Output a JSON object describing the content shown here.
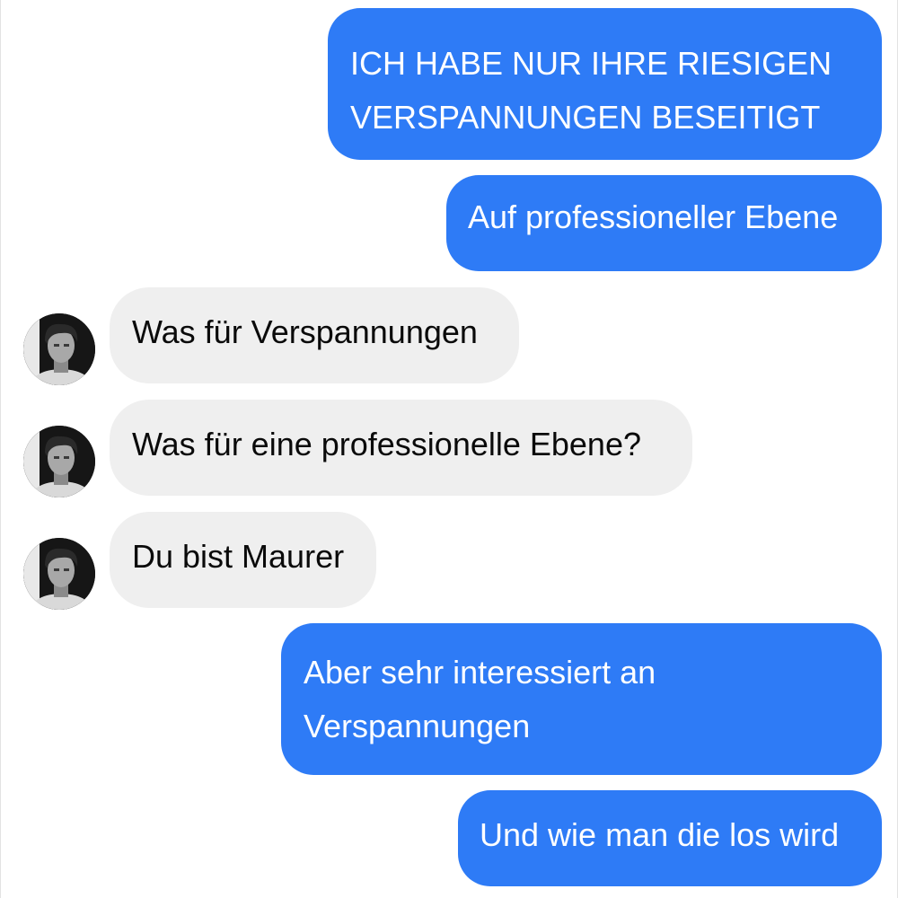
{
  "conversation": {
    "messages": [
      {
        "side": "out",
        "lines": [
          "ICH HABE NUR IHRE RIESIGEN",
          "VERSPANNUNGEN BESEITIGT"
        ]
      },
      {
        "side": "out",
        "lines": [
          "Auf professioneller Ebene"
        ]
      },
      {
        "side": "in",
        "lines": [
          "Was für Verspannungen"
        ]
      },
      {
        "side": "in",
        "lines": [
          "Was für eine professionelle Ebene?"
        ]
      },
      {
        "side": "in",
        "lines": [
          "Du bist Maurer"
        ]
      },
      {
        "side": "out",
        "lines": [
          "Aber sehr interessiert an",
          "Verspannungen"
        ]
      },
      {
        "side": "out",
        "lines": [
          "Und wie man die los wird"
        ]
      }
    ]
  },
  "colors": {
    "outgoing_bubble": "#2e7bf6",
    "incoming_bubble": "#efefef",
    "outgoing_text": "#ffffff",
    "incoming_text": "#0a0a0a"
  },
  "avatar_icon": "contact-avatar-icon"
}
